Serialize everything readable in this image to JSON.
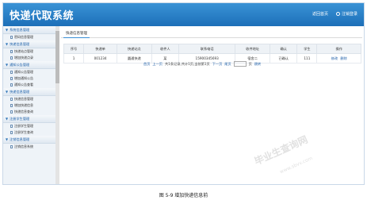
{
  "header": {
    "title": "快递代取系统",
    "home_link": "返回首页",
    "logout_link": "注销登录"
  },
  "sidebar": {
    "groups": [
      {
        "label": "系统信息管理",
        "items": [
          "密码信息管理"
        ]
      },
      {
        "label": "快递信息管理",
        "items": [
          "快递站点管理",
          "增加快递点录"
        ]
      },
      {
        "label": "通知公告管理",
        "items": [
          "通知公告管理",
          "增加通知公告",
          "通知公告查看"
        ]
      },
      {
        "label": "快递信息管理",
        "items": [
          "快递信息管理",
          "增加快递信息",
          "快递信息查询"
        ]
      },
      {
        "label": "注册学生管理",
        "items": [
          "注册学生管理",
          "注册学生查询"
        ]
      },
      {
        "label": "注销信息管理",
        "items": [
          "注销信息系统"
        ]
      }
    ]
  },
  "main": {
    "tab": "快递信息管理",
    "table": {
      "columns": [
        "序号",
        "快递单",
        "快递站点",
        "收件人",
        "联系电话",
        "收件地址",
        "确认",
        "学生",
        "操作"
      ],
      "rows": [
        {
          "cells": [
            "1",
            "001234",
            "圆通快递",
            "某",
            "15900345693",
            "宿舍二",
            "已确认",
            "111"
          ],
          "actions": [
            "修改",
            "删除"
          ]
        }
      ]
    },
    "pager": {
      "first": "首页",
      "prev": "上一页",
      "info": "共1条记录,共计1页,当前第1页",
      "next": "下一页",
      "last": "尾页",
      "goto_label": "页",
      "jump": "跳转"
    }
  },
  "caption": "图 5-9 增加快递信息前",
  "watermark": {
    "main": "毕业生查询网",
    "sub": "www.sbvv.com"
  }
}
